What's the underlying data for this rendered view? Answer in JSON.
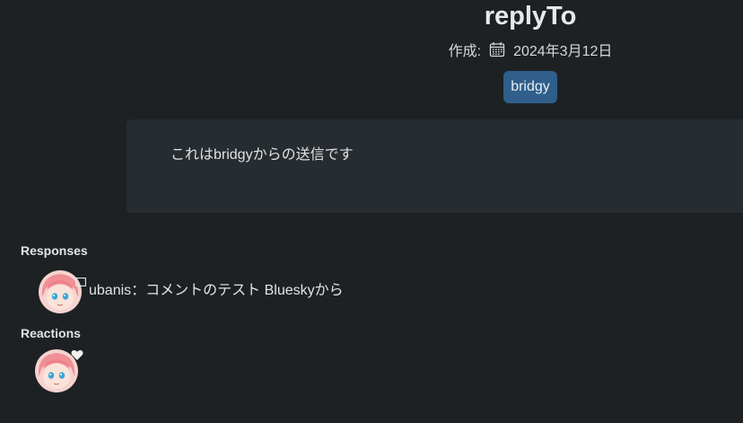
{
  "post": {
    "title": "replyTo",
    "created_label": "作成:",
    "created_date": "2024年3月12日",
    "tag": "bridgy",
    "body": "これはbridgyからの送信です"
  },
  "responses": {
    "heading": "Responses",
    "items": [
      {
        "author": "ubanis",
        "separator": "：",
        "text": "コメントのテスト Blueskyから",
        "icon": "comment-icon"
      }
    ]
  },
  "reactions": {
    "heading": "Reactions",
    "items": [
      {
        "icon": "heart-icon"
      }
    ]
  },
  "colors": {
    "background": "#1d2124",
    "card": "#262c30",
    "tag": "#2f5f8a",
    "text": "#e4e6e8"
  }
}
